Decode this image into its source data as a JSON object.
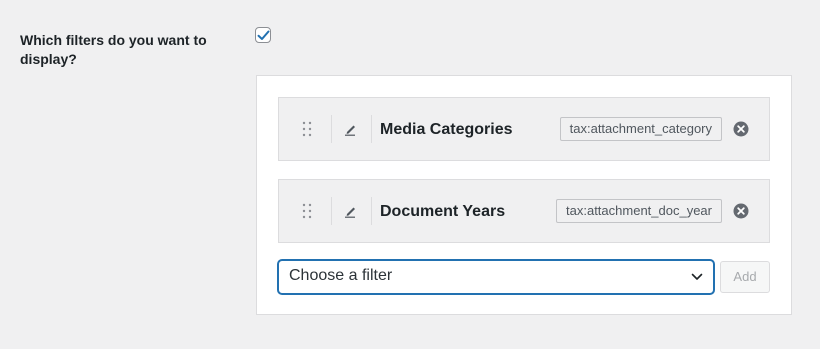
{
  "setting": {
    "label": "Which filters do you want to display?",
    "checked": true
  },
  "filters": [
    {
      "name": "Media Categories",
      "taxonomy": "tax:attachment_category"
    },
    {
      "name": "Document Years",
      "taxonomy": "tax:attachment_doc_year"
    }
  ],
  "filter_select": {
    "selected": "Choose a filter"
  },
  "add_button": {
    "label": "Add",
    "disabled": true
  },
  "icons": {
    "drag": "drag-handle-icon",
    "edit": "pencil-icon",
    "remove": "remove-circle-icon",
    "select": "chevron-down-icon",
    "checkbox": "checkmark-icon"
  },
  "colors": {
    "accent": "#2271b1",
    "background": "#f0f0f1",
    "panel": "#ffffff",
    "text": "#1d2327"
  }
}
